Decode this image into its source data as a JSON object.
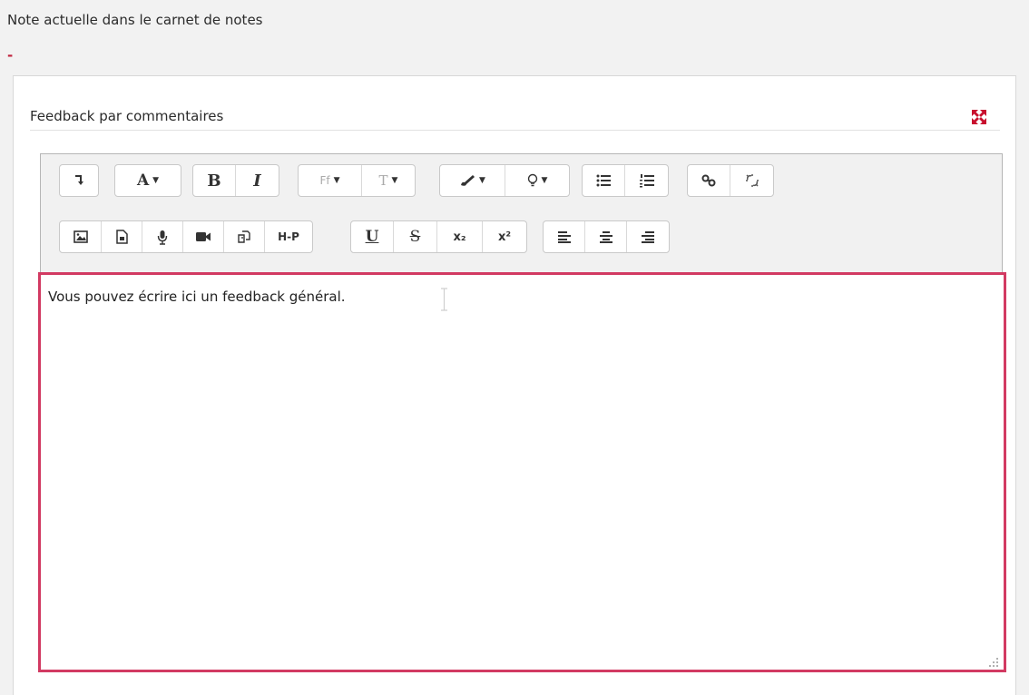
{
  "grade": {
    "label": "Note actuelle dans le carnet de notes",
    "value": "-"
  },
  "feedback": {
    "title": "Feedback par commentaires",
    "expand_icon": "expand-arrows-icon",
    "body_text": "Vous pouvez écrire ici un feedback général."
  },
  "toolbar": {
    "row1": [
      {
        "name": "toolbar-toggle-button",
        "icon": "toggle-arrow-icon"
      },
      {
        "name": "font-style-button",
        "label": "A"
      },
      {
        "name": "bold-button",
        "label": "B"
      },
      {
        "name": "italic-button",
        "label": "I"
      },
      {
        "name": "font-family-button",
        "label": "Ff"
      },
      {
        "name": "font-size-button",
        "label": "T"
      },
      {
        "name": "text-color-button",
        "icon": "brush-icon"
      },
      {
        "name": "background-color-button",
        "icon": "bulb-icon"
      },
      {
        "name": "unordered-list-button",
        "icon": "bullet-list-icon"
      },
      {
        "name": "ordered-list-button",
        "icon": "numbered-list-icon"
      },
      {
        "name": "link-button",
        "icon": "link-icon"
      },
      {
        "name": "unlink-button",
        "icon": "unlink-icon"
      }
    ],
    "row2": [
      {
        "name": "image-button",
        "icon": "image-icon"
      },
      {
        "name": "media-button",
        "icon": "file-media-icon"
      },
      {
        "name": "record-audio-button",
        "icon": "microphone-icon"
      },
      {
        "name": "record-video-button",
        "icon": "video-camera-icon"
      },
      {
        "name": "manage-files-button",
        "icon": "copy-files-icon"
      },
      {
        "name": "h5p-button",
        "label": "H-P"
      },
      {
        "name": "underline-button",
        "label": "U"
      },
      {
        "name": "strikethrough-button",
        "label": "S"
      },
      {
        "name": "subscript-button",
        "label": "x₂"
      },
      {
        "name": "superscript-button",
        "label": "x²"
      },
      {
        "name": "align-left-button",
        "icon": "align-left-icon"
      },
      {
        "name": "align-center-button",
        "icon": "align-center-icon"
      },
      {
        "name": "align-right-button",
        "icon": "align-right-icon"
      }
    ]
  },
  "colors": {
    "accent": "#d23a62",
    "grade_value": "#c0223c",
    "panel_bg": "#f2f2f2",
    "toolbar_bg": "#f1f1f1"
  }
}
